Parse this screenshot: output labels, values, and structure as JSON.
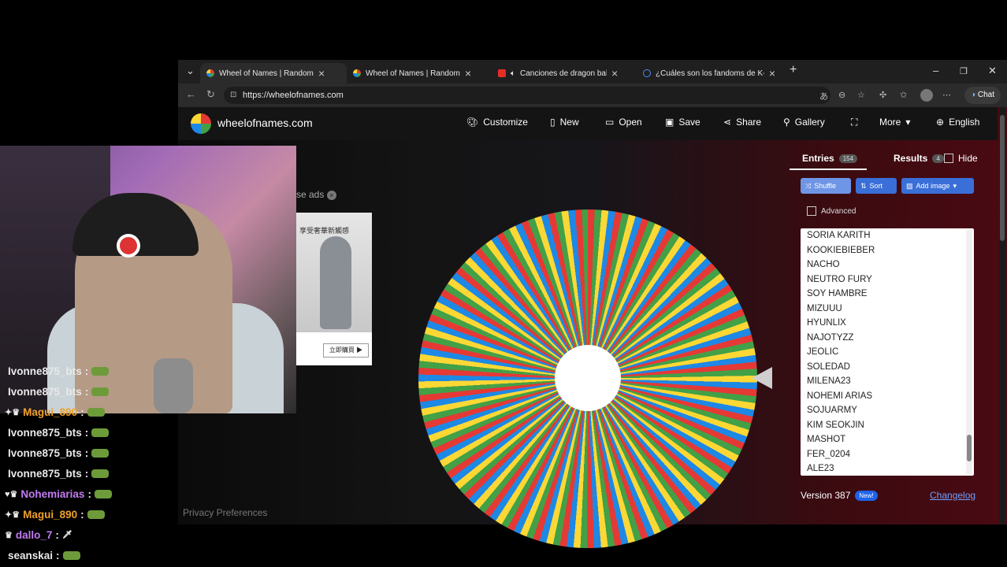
{
  "browser": {
    "tabs": [
      {
        "title": "Wheel of Names | Random name p",
        "active": true,
        "icon": "wheel-favicon"
      },
      {
        "title": "Wheel of Names | Random name p",
        "active": false,
        "icon": "wheel-favicon"
      },
      {
        "title": "Canciones de dragon ball z pe",
        "active": false,
        "icon": "youtube-favicon"
      },
      {
        "title": "¿Cuáles son los fandoms de K-Pop",
        "active": false,
        "icon": "search-favicon"
      }
    ],
    "url": "https://wheelofnames.com",
    "chat_label": "Chat"
  },
  "site": {
    "name": "wheelofnames.com",
    "nav": {
      "customize": "Customize",
      "new": "New",
      "open": "Open",
      "save": "Save",
      "share": "Share",
      "gallery": "Gallery",
      "more": "More",
      "language": "English"
    },
    "ad_close_text": "se ads",
    "ad_text": "享受奢華新觸感",
    "ad_button": "立即購買 ▶",
    "privacy": "Privacy Preferences"
  },
  "panel": {
    "entries_tab": "Entries",
    "entries_count": "154",
    "results_tab": "Results",
    "results_count": "4",
    "hide_label": "Hide",
    "shuffle_label": "Shuffle",
    "sort_label": "Sort",
    "add_image_label": "Add image",
    "advanced_label": "Advanced",
    "entries": [
      "SORIA KARITH",
      "KOOKIEBIEBER",
      "NACHO",
      "NEUTRO FURY",
      "SOY HAMBRE",
      "MIZUUU",
      "HYUNLIX",
      "NAJOTYZZ",
      "JEOLIC",
      "SOLEDAD",
      "MILENA23",
      "NOHEMI ARIAS",
      "SOJUARMY",
      "KIM SEOKJIN",
      "MASHOT",
      "FER_0204",
      "ALE23"
    ],
    "version": "Version 387",
    "new_badge": "New!",
    "changelog": "Changelog"
  },
  "chat": [
    {
      "user": "Ivonne875_bts",
      "color": "#e9e9ea",
      "badges": ""
    },
    {
      "user": "Ivonne875_bts",
      "color": "#e9e9ea",
      "badges": ""
    },
    {
      "user": "Magui_890",
      "color": "#f0a02a",
      "badges": "✦♛"
    },
    {
      "user": "Ivonne875_bts",
      "color": "#e9e9ea",
      "badges": ""
    },
    {
      "user": "Ivonne875_bts",
      "color": "#e9e9ea",
      "badges": ""
    },
    {
      "user": "Ivonne875_bts",
      "color": "#e9e9ea",
      "badges": ""
    },
    {
      "user": "Nohemiarias",
      "color": "#c27cf2",
      "badges": "♥♛"
    },
    {
      "user": "Magui_890",
      "color": "#f0a02a",
      "badges": "✦♛"
    },
    {
      "user": "dallo_7",
      "color": "#c27cf2",
      "badges": "♛"
    },
    {
      "user": "seanskai",
      "color": "#e9e9ea",
      "badges": ""
    }
  ]
}
